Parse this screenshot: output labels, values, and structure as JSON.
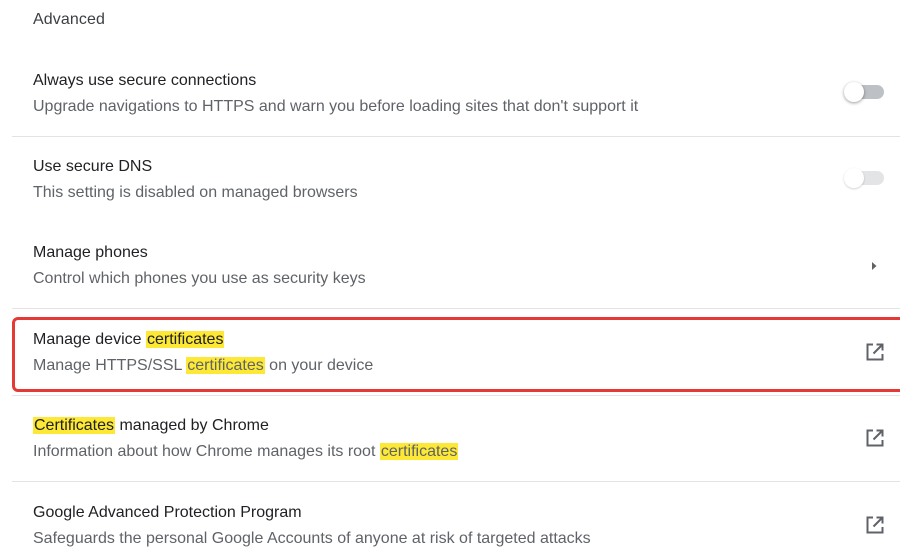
{
  "section": {
    "title": "Advanced"
  },
  "rows": [
    {
      "label": "Always use secure connections",
      "sublabel": "Upgrade navigations to HTTPS and warn you before loading sites that don't support it",
      "control": "toggle",
      "toggle_state": "off"
    },
    {
      "label": "Use secure DNS",
      "sublabel": "This setting is disabled on managed browsers",
      "control": "toggle",
      "toggle_state": "off-disabled"
    },
    {
      "label": "Manage phones",
      "sublabel": "Control which phones you use as security keys",
      "control": "arrow-right-icon"
    },
    {
      "label_parts": [
        "Manage device ",
        "certificates"
      ],
      "sublabel_parts": [
        "Manage HTTPS/SSL ",
        "certificates",
        " on your device"
      ],
      "control": "open-in-new-icon",
      "annotated": true
    },
    {
      "label_parts": [
        "Certificates",
        " managed by Chrome"
      ],
      "sublabel_parts": [
        "Information about how Chrome manages its root ",
        "certificates"
      ],
      "control": "open-in-new-icon"
    },
    {
      "label": "Google Advanced Protection Program",
      "sublabel": "Safeguards the personal Google Accounts of anyone at risk of targeted attacks",
      "control": "open-in-new-icon"
    }
  ],
  "colors": {
    "search_highlight": "#fde935",
    "annotation_border": "#e53935",
    "divider": "#e3e3e3",
    "toggle_track": "#bdc1c6"
  }
}
